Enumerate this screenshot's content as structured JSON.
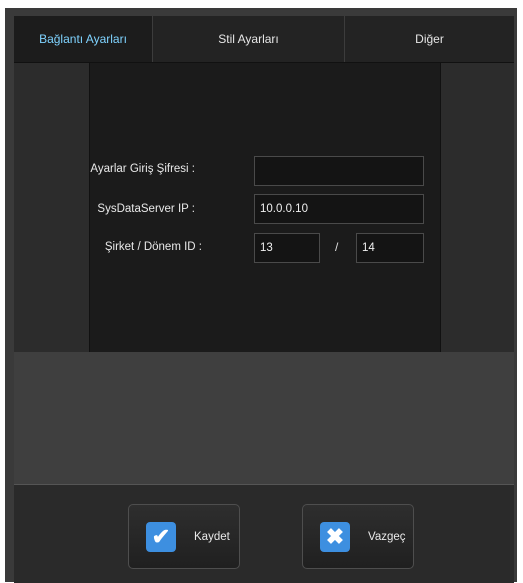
{
  "tabs": [
    {
      "label": "Bağlantı Ayarları",
      "active": true
    },
    {
      "label": "Stil Ayarları",
      "active": false
    },
    {
      "label": "Diğer",
      "active": false
    }
  ],
  "form": {
    "password_label": "Ayarlar Giriş Şifresi :",
    "password_value": "",
    "ip_label": "SysDataServer IP :",
    "ip_value": "10.0.0.10",
    "company_label": "Şirket / Dönem ID :",
    "company_id": "13",
    "separator": "/",
    "period_id": "14"
  },
  "buttons": {
    "save_label": "Kaydet",
    "save_icon": "checkmark-icon",
    "cancel_label": "Vazgeç",
    "cancel_icon": "x-icon"
  },
  "colors": {
    "accent": "#3d8fe0",
    "active_tab_text": "#7fd3ff"
  }
}
